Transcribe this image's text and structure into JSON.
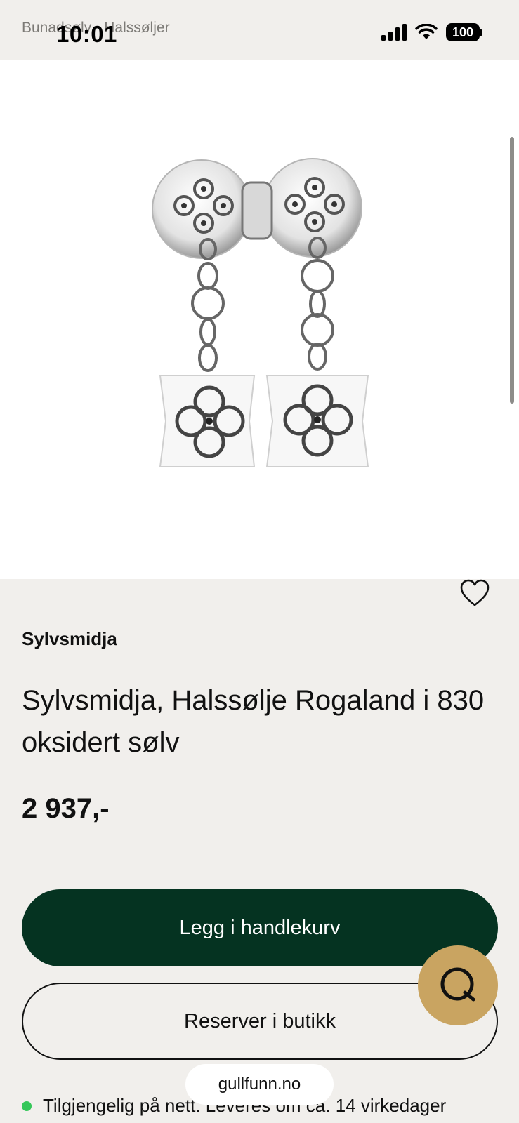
{
  "status_bar": {
    "time": "10:01",
    "battery": "100",
    "icons": [
      "signal-icon",
      "wifi-icon",
      "battery-icon"
    ]
  },
  "breadcrumb": {
    "items": [
      "Bunadsølv",
      "Halssøljer"
    ]
  },
  "product": {
    "brand": "Sylvsmidja",
    "title": "Sylvsmidja, Halssølje Rogaland i 830 oksidert sølv",
    "price": "2 937,-",
    "image_alt": "Halssølje Rogaland"
  },
  "actions": {
    "add_to_cart": "Legg i handlekurv",
    "reserve": "Reserver i butikk"
  },
  "availability": {
    "text": "Tilgjengelig på nett. Leveres om ca. 14 virkedager",
    "status_color": "#35c759"
  },
  "browser": {
    "url": "gullfunn.no"
  },
  "colors": {
    "primary_button": "#053321",
    "chat_button": "#c9a461",
    "background": "#f1efec"
  }
}
